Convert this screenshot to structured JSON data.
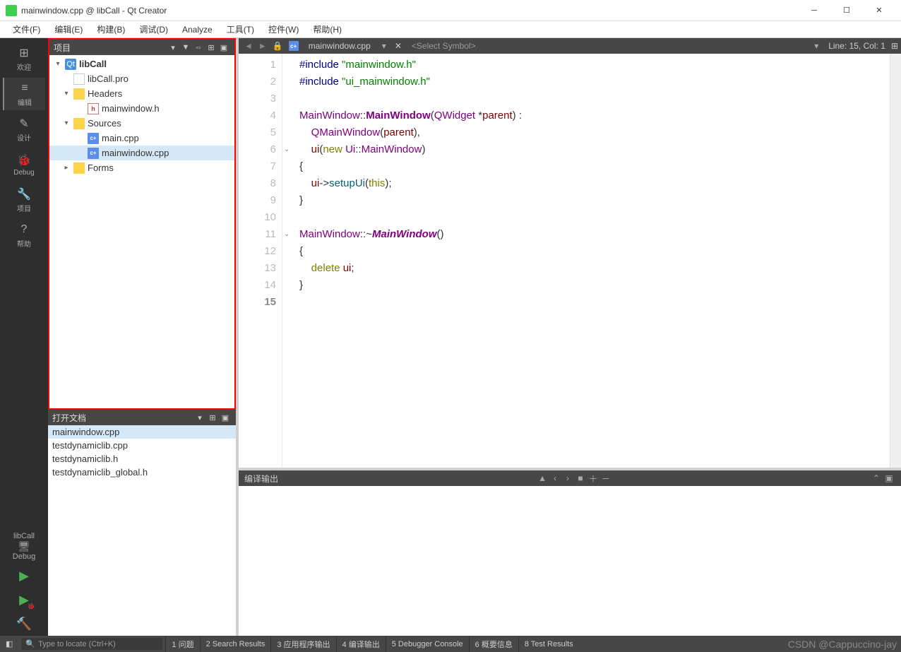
{
  "window": {
    "title": "mainwindow.cpp @ libCall - Qt Creator"
  },
  "menu": [
    "文件(F)",
    "编辑(E)",
    "构建(B)",
    "调试(D)",
    "Analyze",
    "工具(T)",
    "控件(W)",
    "帮助(H)"
  ],
  "rail": [
    {
      "label": "欢迎",
      "icon": "⊞"
    },
    {
      "label": "编辑",
      "icon": "≡",
      "active": true
    },
    {
      "label": "设计",
      "icon": "✎"
    },
    {
      "label": "Debug",
      "icon": "🐞"
    },
    {
      "label": "项目",
      "icon": "🔧"
    },
    {
      "label": "帮助",
      "icon": "?"
    }
  ],
  "kit": {
    "name": "libCall",
    "mode": "Debug"
  },
  "projectPanel": {
    "title": "项目"
  },
  "tree": [
    {
      "depth": 0,
      "arrow": "▾",
      "icon": "proj",
      "label": "libCall",
      "bold": true
    },
    {
      "depth": 1,
      "arrow": "",
      "icon": "file",
      "label": "libCall.pro"
    },
    {
      "depth": 1,
      "arrow": "▾",
      "icon": "folder",
      "label": "Headers"
    },
    {
      "depth": 2,
      "arrow": "",
      "icon": "h",
      "label": "mainwindow.h"
    },
    {
      "depth": 1,
      "arrow": "▾",
      "icon": "folder",
      "label": "Sources"
    },
    {
      "depth": 2,
      "arrow": "",
      "icon": "cpp",
      "label": "main.cpp"
    },
    {
      "depth": 2,
      "arrow": "",
      "icon": "cpp",
      "label": "mainwindow.cpp",
      "selected": true
    },
    {
      "depth": 1,
      "arrow": "▸",
      "icon": "folder",
      "label": "Forms"
    }
  ],
  "openDocs": {
    "title": "打开文档",
    "items": [
      {
        "label": "mainwindow.cpp",
        "selected": true
      },
      {
        "label": "testdynamiclib.cpp"
      },
      {
        "label": "testdynamiclib.h"
      },
      {
        "label": "testdynamiclib_global.h"
      }
    ]
  },
  "editor": {
    "file": "mainwindow.cpp",
    "symbol": "<Select Symbol>",
    "position": "Line: 15, Col: 1",
    "lines": 15,
    "currentLine": 15,
    "folds": [
      6,
      11
    ],
    "code": [
      [
        {
          "c": "kw-pp",
          "t": "#include "
        },
        {
          "c": "kw-inc",
          "t": "\"mainwindow.h\""
        }
      ],
      [
        {
          "c": "kw-pp",
          "t": "#include "
        },
        {
          "c": "kw-inc",
          "t": "\"ui_mainwindow.h\""
        }
      ],
      [],
      [
        {
          "c": "kw-type",
          "t": "MainWindow"
        },
        {
          "t": "::"
        },
        {
          "c": "kw-type-b",
          "t": "MainWindow"
        },
        {
          "t": "("
        },
        {
          "c": "kw-type",
          "t": "QWidget"
        },
        {
          "t": " *"
        },
        {
          "c": "kw-member",
          "t": "parent"
        },
        {
          "t": ") :"
        }
      ],
      [
        {
          "t": "    "
        },
        {
          "c": "kw-type",
          "t": "QMainWindow"
        },
        {
          "t": "("
        },
        {
          "c": "kw-member",
          "t": "parent"
        },
        {
          "t": "),"
        }
      ],
      [
        {
          "t": "    "
        },
        {
          "c": "kw-member",
          "t": "ui"
        },
        {
          "t": "("
        },
        {
          "c": "kw-new",
          "t": "new"
        },
        {
          "t": " "
        },
        {
          "c": "kw-type",
          "t": "Ui"
        },
        {
          "t": "::"
        },
        {
          "c": "kw-type",
          "t": "MainWindow"
        },
        {
          "t": ")"
        }
      ],
      [
        {
          "t": "{"
        }
      ],
      [
        {
          "t": "    "
        },
        {
          "c": "kw-member",
          "t": "ui"
        },
        {
          "t": "->"
        },
        {
          "c": "kw-method",
          "t": "setupUi"
        },
        {
          "t": "("
        },
        {
          "c": "kw-this",
          "t": "this"
        },
        {
          "t": ");"
        }
      ],
      [
        {
          "t": "}"
        }
      ],
      [],
      [
        {
          "c": "kw-type",
          "t": "MainWindow"
        },
        {
          "t": "::~"
        },
        {
          "c": "kw-type-i",
          "t": "MainWindow"
        },
        {
          "t": "()"
        }
      ],
      [
        {
          "t": "{"
        }
      ],
      [
        {
          "t": "    "
        },
        {
          "c": "kw-ret",
          "t": "delete"
        },
        {
          "t": " "
        },
        {
          "c": "kw-member",
          "t": "ui"
        },
        {
          "t": ";"
        }
      ],
      [
        {
          "t": "}"
        }
      ],
      [
        {
          "t": ""
        }
      ]
    ]
  },
  "output": {
    "title": "编译输出"
  },
  "status": {
    "locate_placeholder": "Type to locate (Ctrl+K)",
    "tabs": [
      "1 问题",
      "2 Search Results",
      "3 应用程序输出",
      "4 编译输出",
      "5 Debugger Console",
      "6 概要信息",
      "8 Test Results"
    ]
  },
  "watermark": "CSDN @Cappuccino-jay"
}
